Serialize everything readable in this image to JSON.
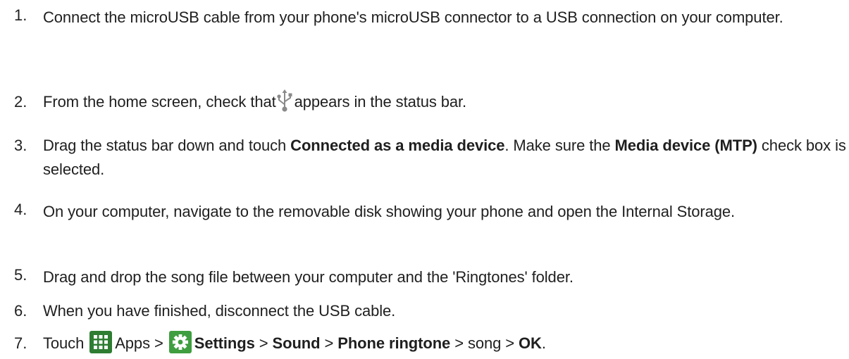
{
  "steps": [
    {
      "number": "1.",
      "text_a": "Connect the microUSB cable from your phone's microUSB connector to a USB connection on your computer."
    },
    {
      "number": "2.",
      "text_a": "From the home screen, check that",
      "text_b": "appears in the status bar.",
      "icon": "usb-icon"
    },
    {
      "number": "3.",
      "text_a": "Drag the status bar down and touch ",
      "bold_a": "Connected as a media device",
      "text_b": ". Make sure the ",
      "bold_b": "Media device (MTP)",
      "text_c": " check box is selected."
    },
    {
      "number": "4.",
      "text_a": "On your computer, navigate to the removable disk showing your phone and open the Internal Storage."
    },
    {
      "number": "5.",
      "text_a": "Drag and drop the song file between your computer and the 'Ringtones' folder."
    },
    {
      "number": "6.",
      "text_a": "When you have finished, disconnect the USB cable."
    },
    {
      "number": "7.",
      "text_a": "Touch ",
      "apps_label": "Apps",
      "sep1": " > ",
      "settings_label": "Settings",
      "sep2": " > ",
      "sound_label": "Sound",
      "sep3": " > ",
      "ringtone_label": "Phone ringtone",
      "sep4": " > song > ",
      "ok_label": "OK",
      "end": ".",
      "icons": [
        "apps-grid-icon",
        "settings-gear-icon"
      ]
    }
  ],
  "colors": {
    "text": "#1f1f1f",
    "usb_icon": "#8a8a8a",
    "apps_icon_bg": "#2e7d32",
    "settings_icon_bg": "#3f9e3f"
  }
}
